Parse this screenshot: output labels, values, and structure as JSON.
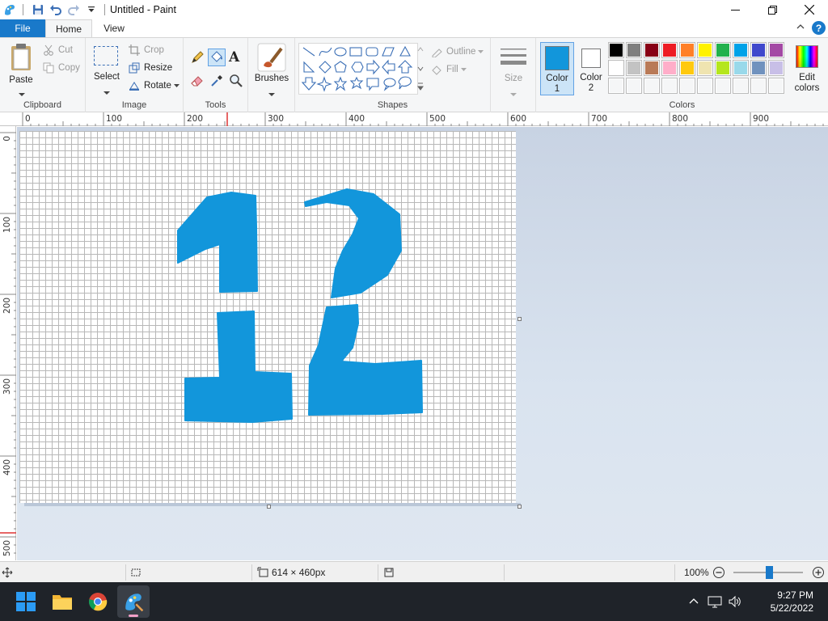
{
  "window": {
    "title": "Untitled - Paint"
  },
  "tabs": {
    "file": "File",
    "home": "Home",
    "view": "View"
  },
  "clipboard": {
    "paste": "Paste",
    "cut": "Cut",
    "copy": "Copy",
    "label": "Clipboard"
  },
  "image": {
    "select": "Select",
    "crop": "Crop",
    "resize": "Resize",
    "rotate": "Rotate",
    "label": "Image"
  },
  "tools": {
    "label": "Tools"
  },
  "brushes": {
    "label": "Brushes"
  },
  "shapes": {
    "label": "Shapes",
    "outline": "Outline",
    "fill": "Fill"
  },
  "size": {
    "label": "Size"
  },
  "colors": {
    "color1_label": "Color",
    "color1_num": "1",
    "color2_label": "Color",
    "color2_num": "2",
    "edit_label1": "Edit",
    "edit_label2": "colors",
    "label": "Colors",
    "color1": "#1296db",
    "color2": "#ffffff",
    "palette_row1": [
      "#000000",
      "#7f7f7f",
      "#880015",
      "#ed1c24",
      "#ff7f27",
      "#fff200",
      "#22b14c",
      "#00a2e8",
      "#3f48cc",
      "#a349a4"
    ],
    "palette_row2": [
      "#ffffff",
      "#c3c3c3",
      "#b97a57",
      "#ffaec9",
      "#ffc90e",
      "#efe4b0",
      "#b5e61d",
      "#99d9ea",
      "#7092be",
      "#c8bfe7"
    ]
  },
  "ruler": {
    "top": [
      "0",
      "100",
      "200",
      "300",
      "400",
      "500",
      "600",
      "700",
      "800",
      "900"
    ],
    "left": [
      "0",
      "100",
      "200",
      "300",
      "400",
      "500"
    ]
  },
  "drawing": {
    "stroke_color": "#1296db",
    "text": "12"
  },
  "status": {
    "canvas_size": "614 × 460px",
    "zoom": "100%"
  },
  "taskbar": {
    "time": "9:27 PM",
    "date": "5/22/2022"
  }
}
